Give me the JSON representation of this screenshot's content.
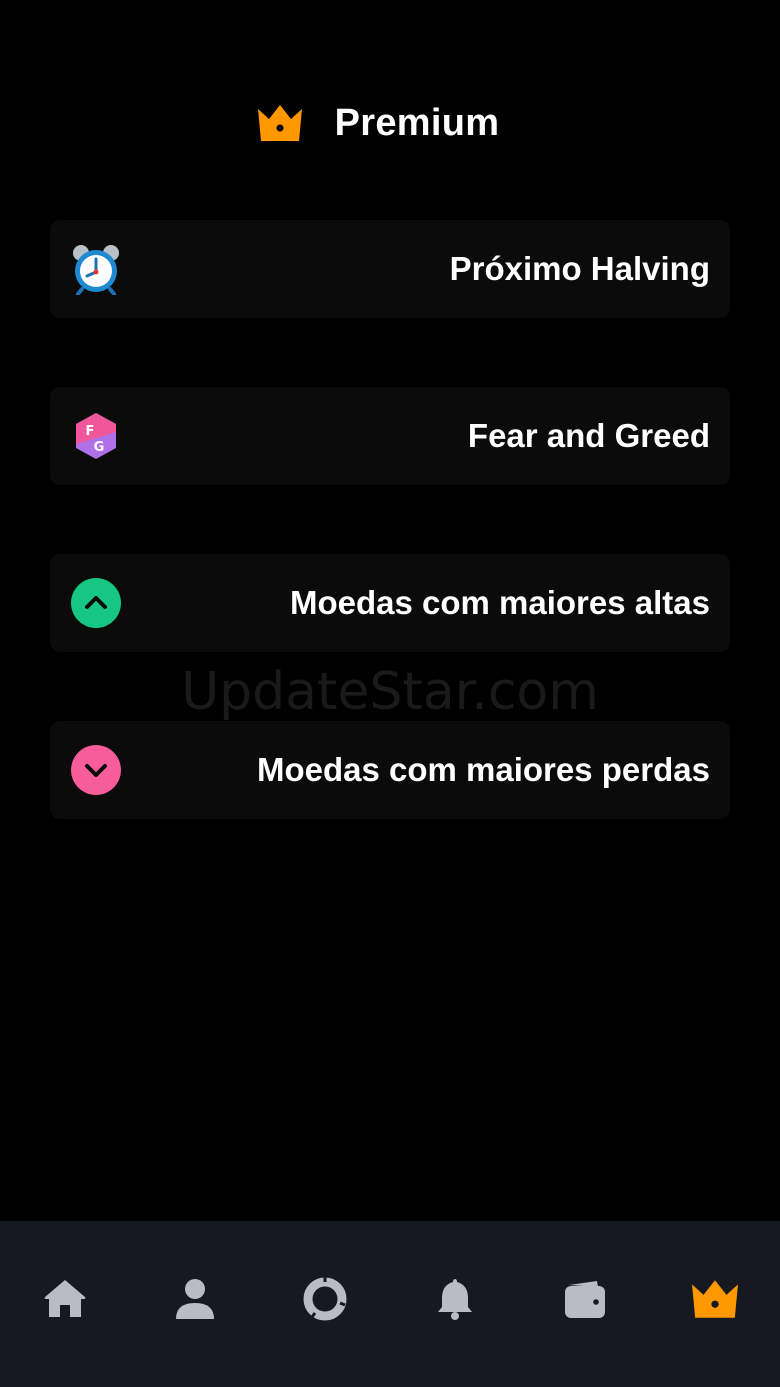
{
  "header": {
    "title": "Premium",
    "icon": "crown-icon",
    "icon_color": "#ff9800"
  },
  "menu": {
    "items": [
      {
        "label": "Próximo Halving",
        "icon": "alarm-clock-icon"
      },
      {
        "label": "Fear and Greed",
        "icon": "fear-greed-icon",
        "icon_letters": [
          "F",
          "G"
        ]
      },
      {
        "label": "Moedas com maiores altas",
        "icon": "chevron-up-circle-icon",
        "icon_color": "#16c784"
      },
      {
        "label": "Moedas com maiores perdas",
        "icon": "chevron-down-circle-icon",
        "icon_color": "#f75c9b"
      }
    ]
  },
  "watermark": "UpdateStar.com",
  "bottom_nav": {
    "items": [
      {
        "name": "home",
        "icon": "home-icon",
        "active": false
      },
      {
        "name": "profile",
        "icon": "user-icon",
        "active": false
      },
      {
        "name": "portfolio",
        "icon": "pie-chart-icon",
        "active": false
      },
      {
        "name": "notifications",
        "icon": "bell-icon",
        "active": false
      },
      {
        "name": "wallet",
        "icon": "wallet-icon",
        "active": false
      },
      {
        "name": "premium",
        "icon": "crown-icon",
        "active": true
      }
    ],
    "inactive_color": "#b9bcc2",
    "active_color": "#ff9800"
  }
}
